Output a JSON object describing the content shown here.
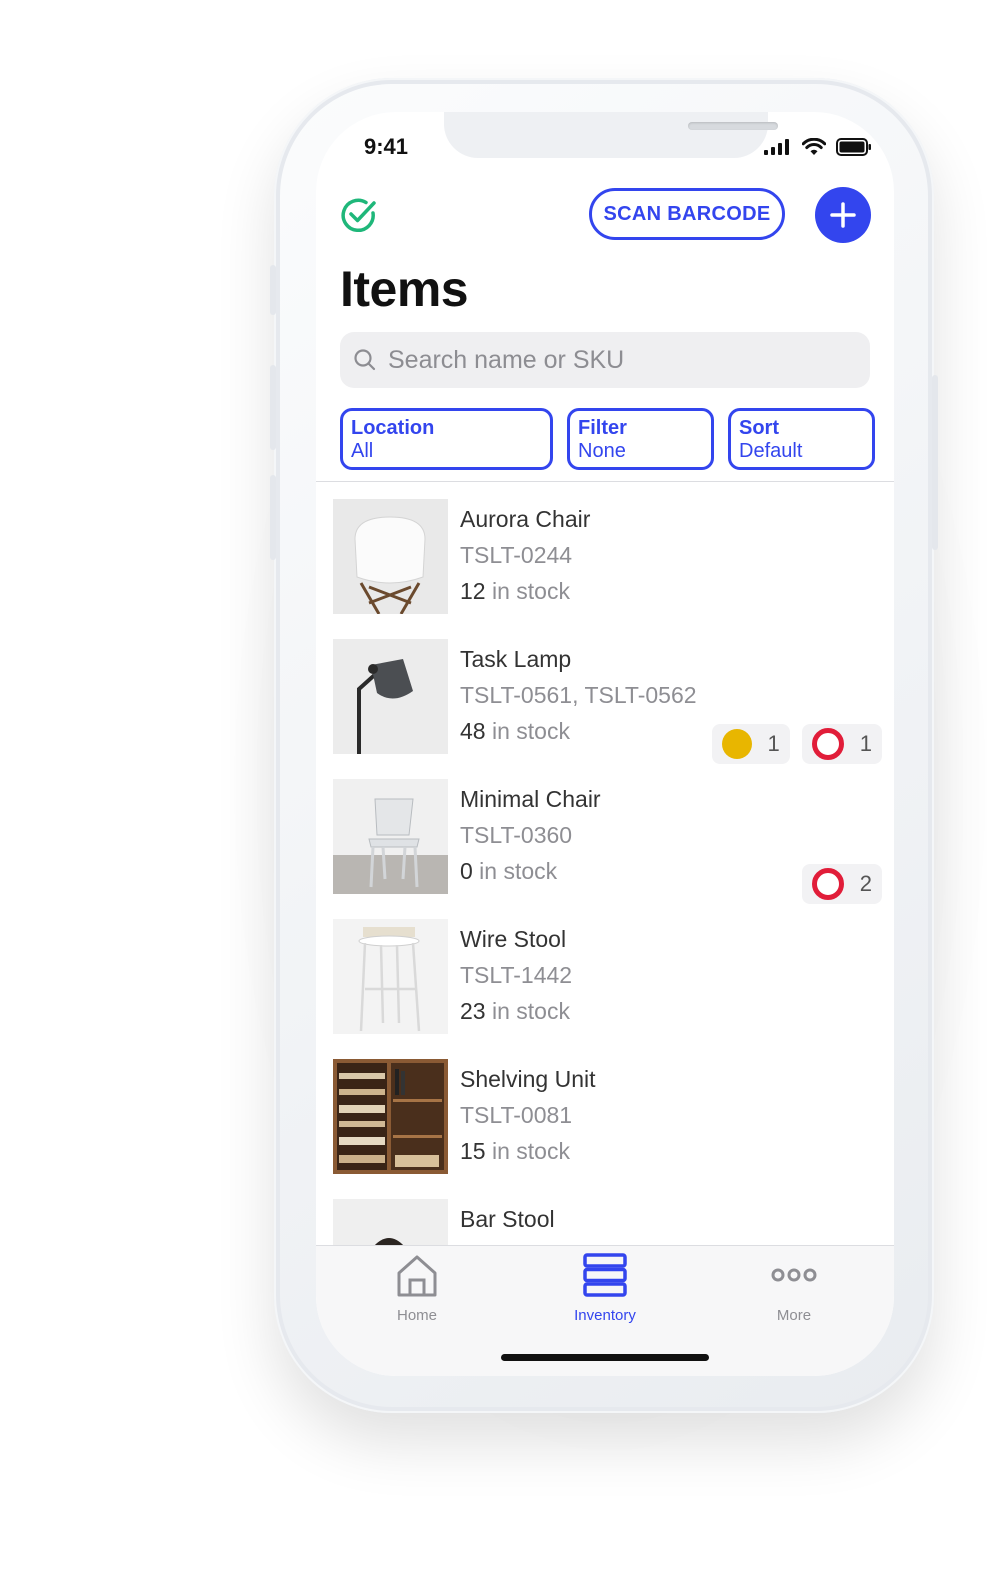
{
  "status": {
    "time": "9:41"
  },
  "header": {
    "scan_label": "SCAN BARCODE",
    "title": "Items"
  },
  "search": {
    "placeholder": "Search name or SKU"
  },
  "filters": [
    {
      "key": "Location",
      "value": "All"
    },
    {
      "key": "Filter",
      "value": "None"
    },
    {
      "key": "Sort",
      "value": "Default"
    }
  ],
  "items": [
    {
      "name": "Aurora Chair",
      "sku": "TSLT-0244",
      "stock": "12",
      "stock_suffix": " in stock",
      "badges": []
    },
    {
      "name": "Task Lamp",
      "sku": "TSLT-0561, TSLT-0562",
      "stock": "48",
      "stock_suffix": " in stock",
      "badges": [
        {
          "kind": "yellow-dot",
          "count": "1"
        },
        {
          "kind": "red-ring",
          "count": "1"
        }
      ]
    },
    {
      "name": "Minimal Chair",
      "sku": "TSLT-0360",
      "stock": "0",
      "stock_suffix": " in stock",
      "badges": [
        {
          "kind": "red-ring",
          "count": "2"
        }
      ]
    },
    {
      "name": "Wire Stool",
      "sku": "TSLT-1442",
      "stock": "23",
      "stock_suffix": " in stock",
      "badges": []
    },
    {
      "name": "Shelving Unit",
      "sku": "TSLT-0081",
      "stock": "15",
      "stock_suffix": " in stock",
      "badges": []
    },
    {
      "name": "Bar Stool",
      "sku": "",
      "stock": "",
      "stock_suffix": "",
      "badges": []
    }
  ],
  "tabs": [
    {
      "label": "Home",
      "icon": "home-icon"
    },
    {
      "label": "Inventory",
      "icon": "inventory-icon"
    },
    {
      "label": "More",
      "icon": "more-icon"
    }
  ],
  "colors": {
    "accent": "#3345ee",
    "warning": "#e8b600",
    "alert": "#e11d39",
    "success": "#1fb77a"
  }
}
